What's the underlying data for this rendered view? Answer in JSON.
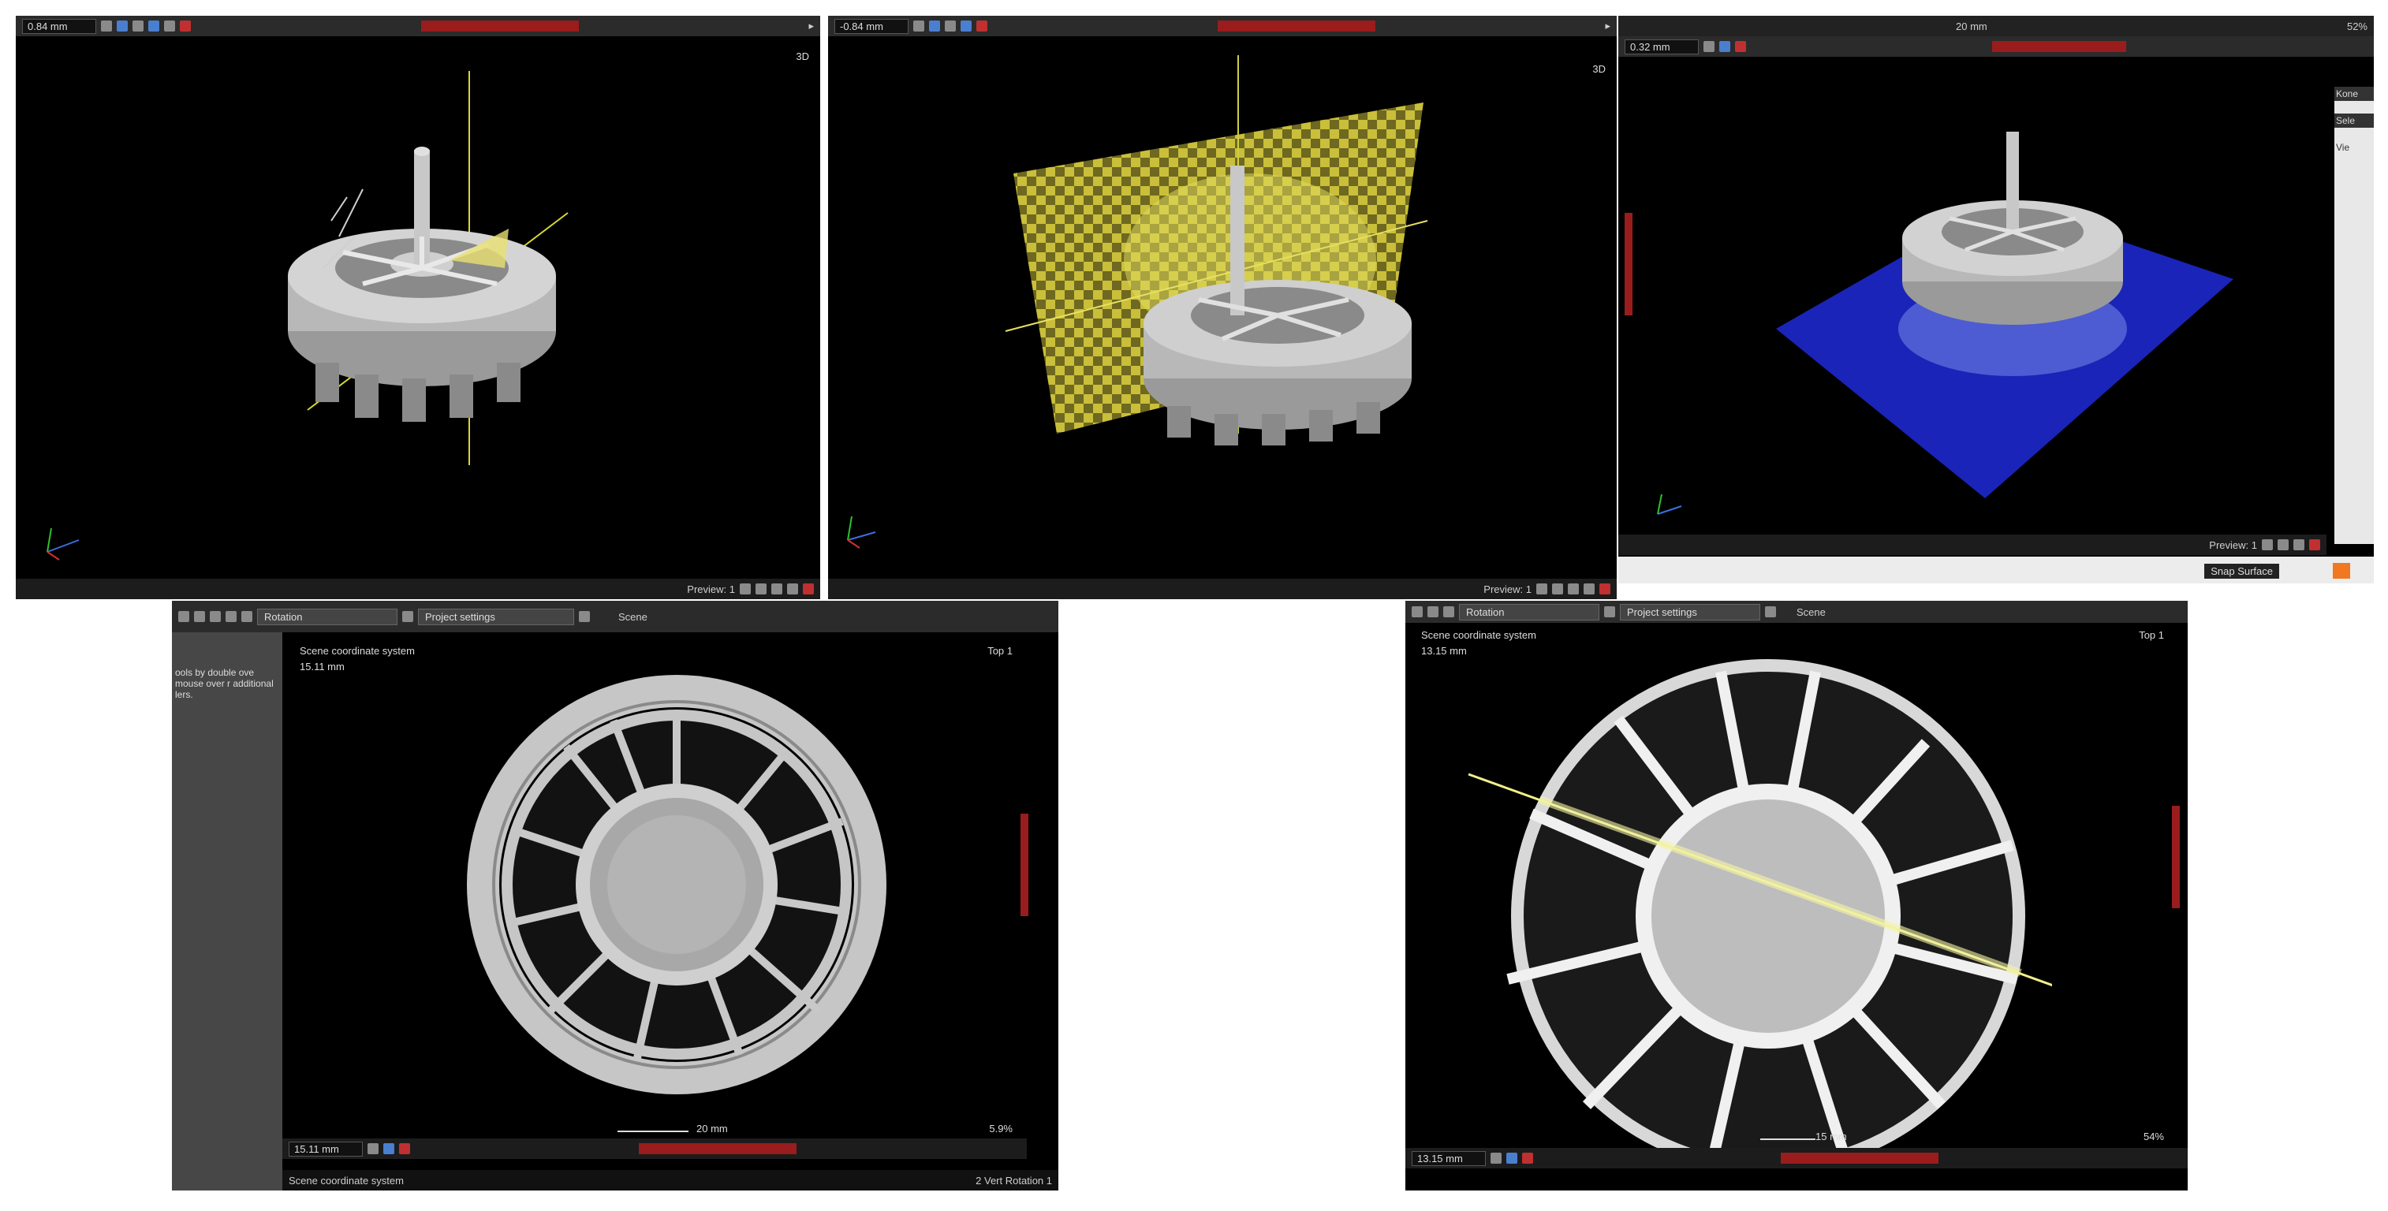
{
  "panel_a": {
    "scale_value": "0.84 mm",
    "view_label": "3D",
    "footer_label": "Preview: 1"
  },
  "panel_b": {
    "scale_value": "-0.84 mm",
    "view_label": "3D",
    "footer_label": "Preview: 1"
  },
  "panel_c": {
    "scale_value": "0.32 mm",
    "scalebar_label": "20 mm",
    "zoom": "52%",
    "footer_label": "Preview: 1",
    "snap_label": "Snap Surface",
    "side_labels": [
      "Kone",
      "Sele",
      "Vie"
    ]
  },
  "panel_d": {
    "toolbar": {
      "rotation": "Rotation",
      "project_settings": "Project settings",
      "scene": "Scene"
    },
    "side_text": "ools by double ove mouse over r additional lers.",
    "coord_title": "Scene coordinate system",
    "coord_value": "15.11 mm",
    "view_label": "Top 1",
    "scalebar_label": "20 mm",
    "zoom": "5.9%",
    "field_value": "15.11 mm",
    "footer_left": "Scene coordinate system",
    "footer_right": "2 Vert Rotation 1"
  },
  "panel_e": {
    "toolbar": {
      "rotation": "Rotation",
      "project_settings": "Project settings",
      "scene": "Scene"
    },
    "coord_title": "Scene coordinate system",
    "coord_value": "13.15 mm",
    "view_label": "Top 1",
    "scalebar_label": "15 mm",
    "zoom": "54%",
    "field_value": "13.15 mm"
  }
}
